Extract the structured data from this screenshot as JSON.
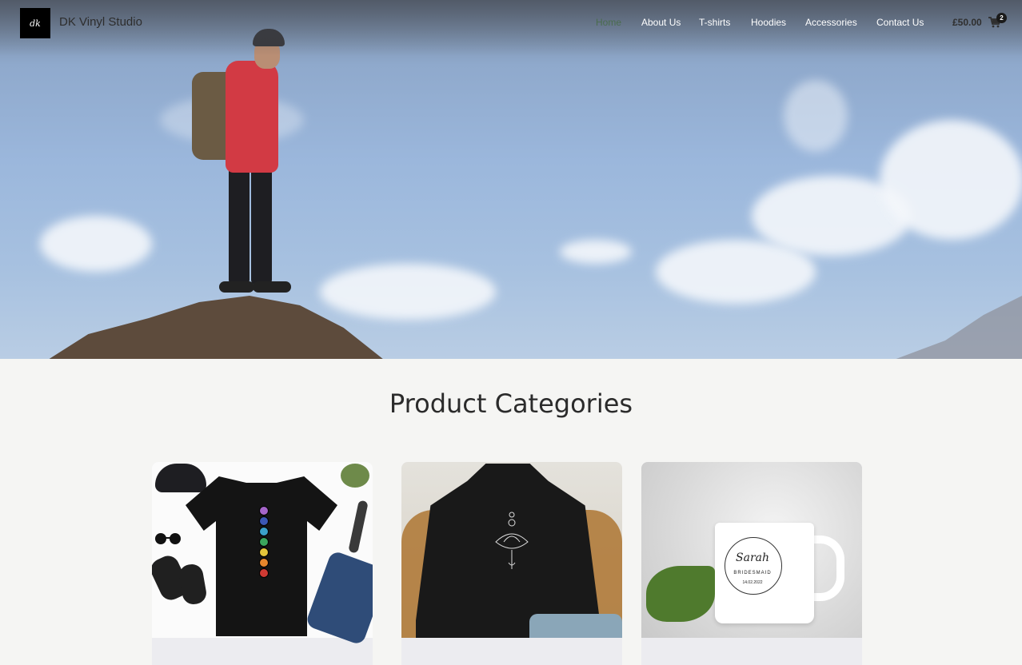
{
  "site": {
    "title": "DK Vinyl Studio",
    "logo_text": "dk"
  },
  "nav": {
    "items": [
      {
        "label": "Home",
        "active": true
      },
      {
        "label": "About Us",
        "active": false
      },
      {
        "label": "T-shirts",
        "active": false
      },
      {
        "label": "Hoodies",
        "active": false
      },
      {
        "label": "Accessories",
        "active": false
      },
      {
        "label": "Contact Us",
        "active": false
      }
    ]
  },
  "cart": {
    "total": "£50.00",
    "count": "2",
    "icon": "cart-icon"
  },
  "hero": {
    "image": "hiker-on-rock-with-sky"
  },
  "section": {
    "title": "Product Categories"
  },
  "categories": [
    {
      "image": "chakra-tshirt-flatlay",
      "label": ""
    },
    {
      "image": "lotus-hoodie-on-chair",
      "label": ""
    },
    {
      "image": "bridesmaid-personalised-mug",
      "label": ""
    }
  ],
  "mug_print": {
    "name": "Sarah",
    "role": "BRIDESMAID",
    "date": "14.02.2022"
  },
  "colors": {
    "active_nav": "#4a6c4e",
    "page_bg": "#f5f5f3",
    "card_footer_bg": "#ececf0"
  }
}
